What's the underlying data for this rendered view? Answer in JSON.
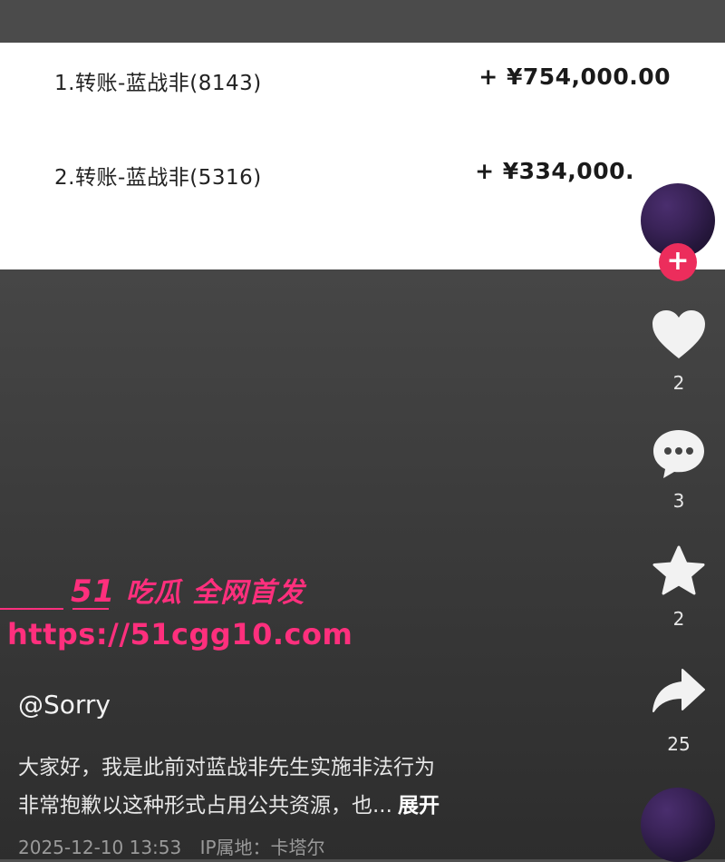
{
  "transactions": [
    {
      "label": "1.转账-蓝战非(8143)",
      "amount": "+ ¥754,000.00"
    },
    {
      "label": "2.转账-蓝战非(5316)",
      "amount": "+ ¥334,000."
    }
  ],
  "actions": {
    "follow_glyph": "+",
    "like_count": "2",
    "comment_count": "3",
    "favorite_count": "2",
    "share_count": "25"
  },
  "watermark": {
    "brand_number": "51",
    "brand_text": "吃瓜 全网首发",
    "url": "https://51cgg10.com"
  },
  "post": {
    "username": "@Sorry",
    "caption_line1": "大家好，我是此前对蓝战非先生实施非法行为",
    "caption_line2": "非常抱歉以这种形式占用公共资源，也...",
    "expand_label": "展开",
    "timestamp": "2025-12-10 13:53",
    "ip_location": "IP属地：卡塔尔"
  },
  "icons": [
    "heart-icon",
    "comment-icon",
    "star-icon",
    "share-icon",
    "plus-icon"
  ],
  "colors": {
    "accent_pink": "#ec2d5c",
    "watermark_pink": "#ff2f7d"
  }
}
